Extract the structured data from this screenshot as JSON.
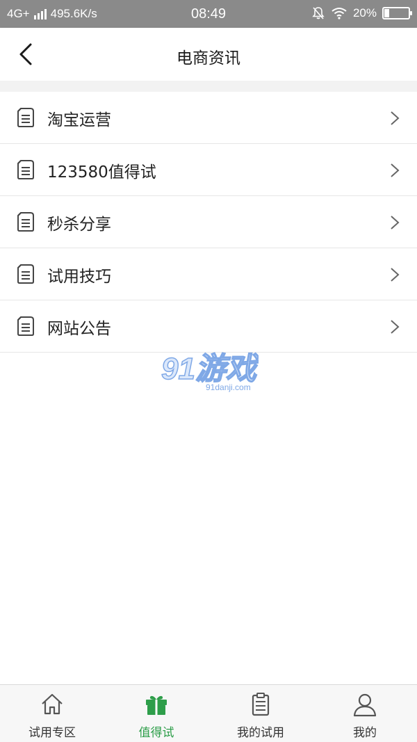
{
  "status_bar": {
    "network": "4G+",
    "speed": "495.6K/s",
    "time": "08:49",
    "battery": "20%",
    "battery_level": 0.2
  },
  "header": {
    "title": "电商资讯",
    "back_icon": "chevron-left-icon"
  },
  "list": {
    "items": [
      {
        "label": "淘宝运营",
        "icon": "document-icon"
      },
      {
        "label": "123580值得试",
        "icon": "document-icon"
      },
      {
        "label": "秒杀分享",
        "icon": "document-icon"
      },
      {
        "label": "试用技巧",
        "icon": "document-icon"
      },
      {
        "label": "网站公告",
        "icon": "document-icon"
      }
    ]
  },
  "watermark": {
    "logo_text": "91游戏",
    "domain": "91danji.com"
  },
  "bottom_nav": {
    "active_color": "#2e9e4a",
    "items": [
      {
        "label": "试用专区",
        "icon": "home-icon",
        "active": false
      },
      {
        "label": "值得试",
        "icon": "gift-icon",
        "active": true
      },
      {
        "label": "我的试用",
        "icon": "clipboard-icon",
        "active": false
      },
      {
        "label": "我的",
        "icon": "user-icon",
        "active": false
      }
    ]
  }
}
